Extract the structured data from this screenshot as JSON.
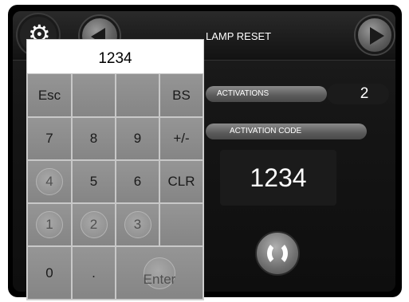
{
  "header": {
    "title": "LAMP RESET"
  },
  "icons": {
    "settings": "gear-icon",
    "back": "back-arrow-icon",
    "forward": "forward-arrow-icon",
    "power": "power-icon"
  },
  "activations": {
    "label": "ACTIVATIONS",
    "value": "2"
  },
  "activation_code": {
    "label": "ACTIVATION CODE",
    "value": "1234"
  },
  "keypad": {
    "display": "1234",
    "keys": {
      "esc": "Esc",
      "bs": "BS",
      "k7": "7",
      "k8": "8",
      "k9": "9",
      "sign": "+/-",
      "k4": "4",
      "k5": "5",
      "k6": "6",
      "clr": "CLR",
      "k1": "1",
      "k2": "2",
      "k3": "3",
      "k0": "0",
      "dot": ".",
      "enter": "Enter"
    }
  }
}
